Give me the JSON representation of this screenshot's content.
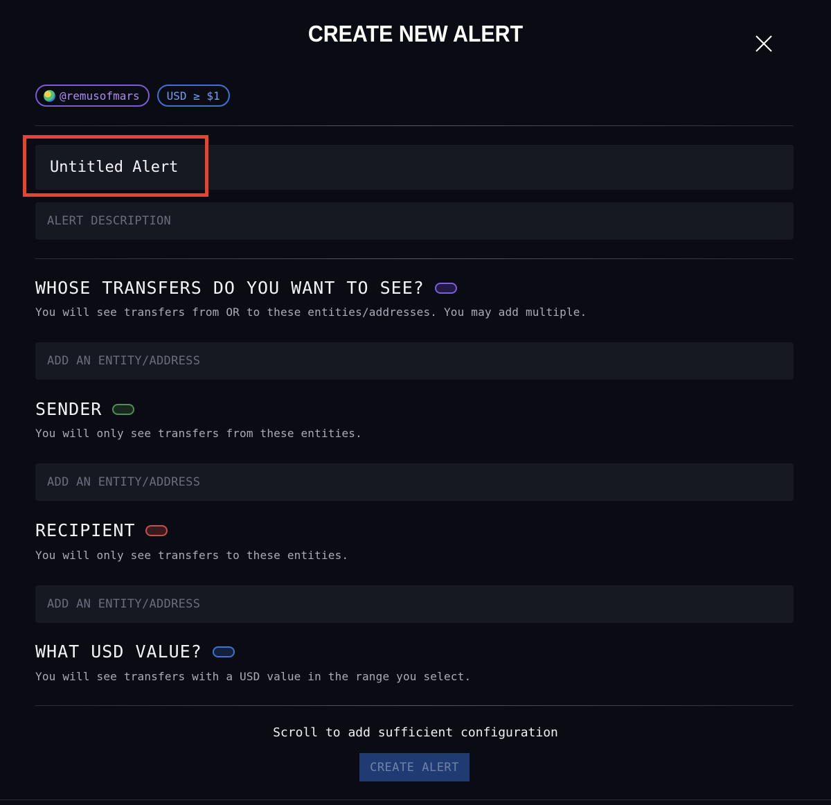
{
  "modal": {
    "title": "CREATE NEW ALERT",
    "close_icon": "close-icon"
  },
  "chips": {
    "user_label": "@remusofmars",
    "usd_label": "USD ≥ $1"
  },
  "alert_name": {
    "value": "Untitled Alert"
  },
  "description": {
    "placeholder": "ALERT DESCRIPTION"
  },
  "sections": {
    "whose": {
      "title": "WHOSE TRANSFERS DO YOU WANT TO SEE?",
      "subtitle": "You will see transfers from OR to these entities/addresses. You may add multiple.",
      "input_placeholder": "ADD AN ENTITY/ADDRESS",
      "toggle_color": "#7a5fe0"
    },
    "sender": {
      "title": "SENDER",
      "subtitle": "You will only see transfers from these entities.",
      "input_placeholder": "ADD AN ENTITY/ADDRESS",
      "toggle_color": "#4f8d5b"
    },
    "recipient": {
      "title": "RECIPIENT",
      "subtitle": "You will only see transfers to these entities.",
      "input_placeholder": "ADD AN ENTITY/ADDRESS",
      "toggle_color": "#c4524c"
    },
    "usd_value": {
      "title": "WHAT USD VALUE?",
      "subtitle": "You will see transfers with a USD value in the range you select.",
      "toggle_color": "#3d74d4"
    }
  },
  "footer": {
    "hint": "Scroll to add sufficient configuration",
    "create_label": "CREATE ALERT"
  },
  "colors": {
    "background": "#0b0c13",
    "field_background": "#161922",
    "highlight": "#e8432d",
    "create_button": "#1f3b72"
  }
}
